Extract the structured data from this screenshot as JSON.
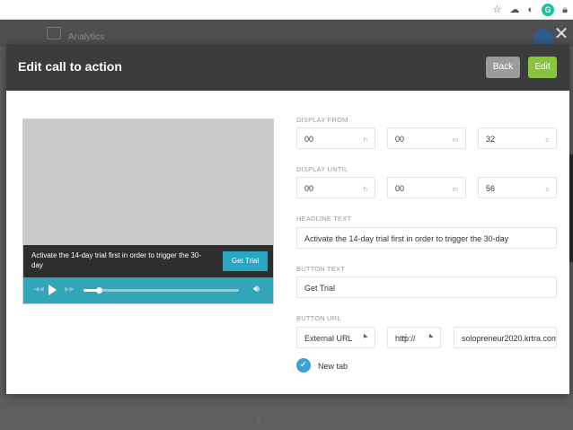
{
  "browser": {
    "icons": [
      "star-icon",
      "cloud-icon",
      "circle-icon",
      "grammarly-icon",
      "lock-icon"
    ],
    "grammarly_letter": "G"
  },
  "background": {
    "nav_label": "Analytics"
  },
  "modal": {
    "title": "Edit call to action",
    "back_label": "Back",
    "edit_label": "Edit",
    "close_glyph": "✕"
  },
  "preview": {
    "cta_text": "Activate the 14-day trial first in order to trigger the 30-day",
    "cta_button": "Get Trial",
    "progress": 0.1
  },
  "form": {
    "display_from": {
      "label": "DISPLAY FROM",
      "hours": "00",
      "hours_unit": "h",
      "minutes": "00",
      "minutes_unit": "m",
      "seconds": "32",
      "seconds_unit": "s"
    },
    "display_until": {
      "label": "DISPLAY UNTIL",
      "hours": "00",
      "hours_unit": "h",
      "minutes": "00",
      "minutes_unit": "m",
      "seconds": "56",
      "seconds_unit": "s"
    },
    "headline": {
      "label": "HEADLINE TEXT",
      "value": "Activate the 14-day trial first in order to trigger the 30-day"
    },
    "button_text": {
      "label": "BUTTON TEXT",
      "value": "Get Trial"
    },
    "button_url": {
      "label": "BUTTON URL",
      "type_value": "External URL",
      "protocol_value": "http://",
      "url_value": "solopreneur2020.krtra.com"
    },
    "new_tab": {
      "label": "New tab",
      "checked": true
    }
  },
  "colors": {
    "accent_teal": "#33a5b8",
    "cta_blue": "#2aa6c3",
    "edit_green": "#8ac43f",
    "back_grey": "#9b9b9b",
    "header_dark": "#3c3c3c",
    "checkbox_blue": "#3aa0d6"
  }
}
